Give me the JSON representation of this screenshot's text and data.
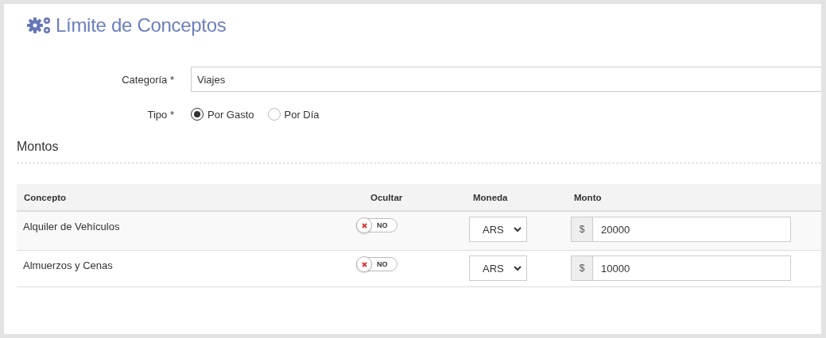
{
  "title": "Límite de Conceptos",
  "category": {
    "label": "Categoría *",
    "value": "Viajes"
  },
  "type": {
    "label": "Tipo *",
    "options": [
      {
        "label": "Por Gasto",
        "selected": true
      },
      {
        "label": "Por Día",
        "selected": false
      }
    ]
  },
  "section_title": "Montos",
  "table": {
    "columns": [
      "Concepto",
      "Ocultar",
      "Moneda",
      "Monto"
    ],
    "rows": [
      {
        "concept": "Alquiler de Vehículos",
        "hide": {
          "on": false,
          "label": "NO"
        },
        "currency": "ARS",
        "prefix": "$",
        "amount": "20000"
      },
      {
        "concept": "Almuerzos y Cenas",
        "hide": {
          "on": false,
          "label": "NO"
        },
        "currency": "ARS",
        "prefix": "$",
        "amount": "10000"
      }
    ]
  }
}
